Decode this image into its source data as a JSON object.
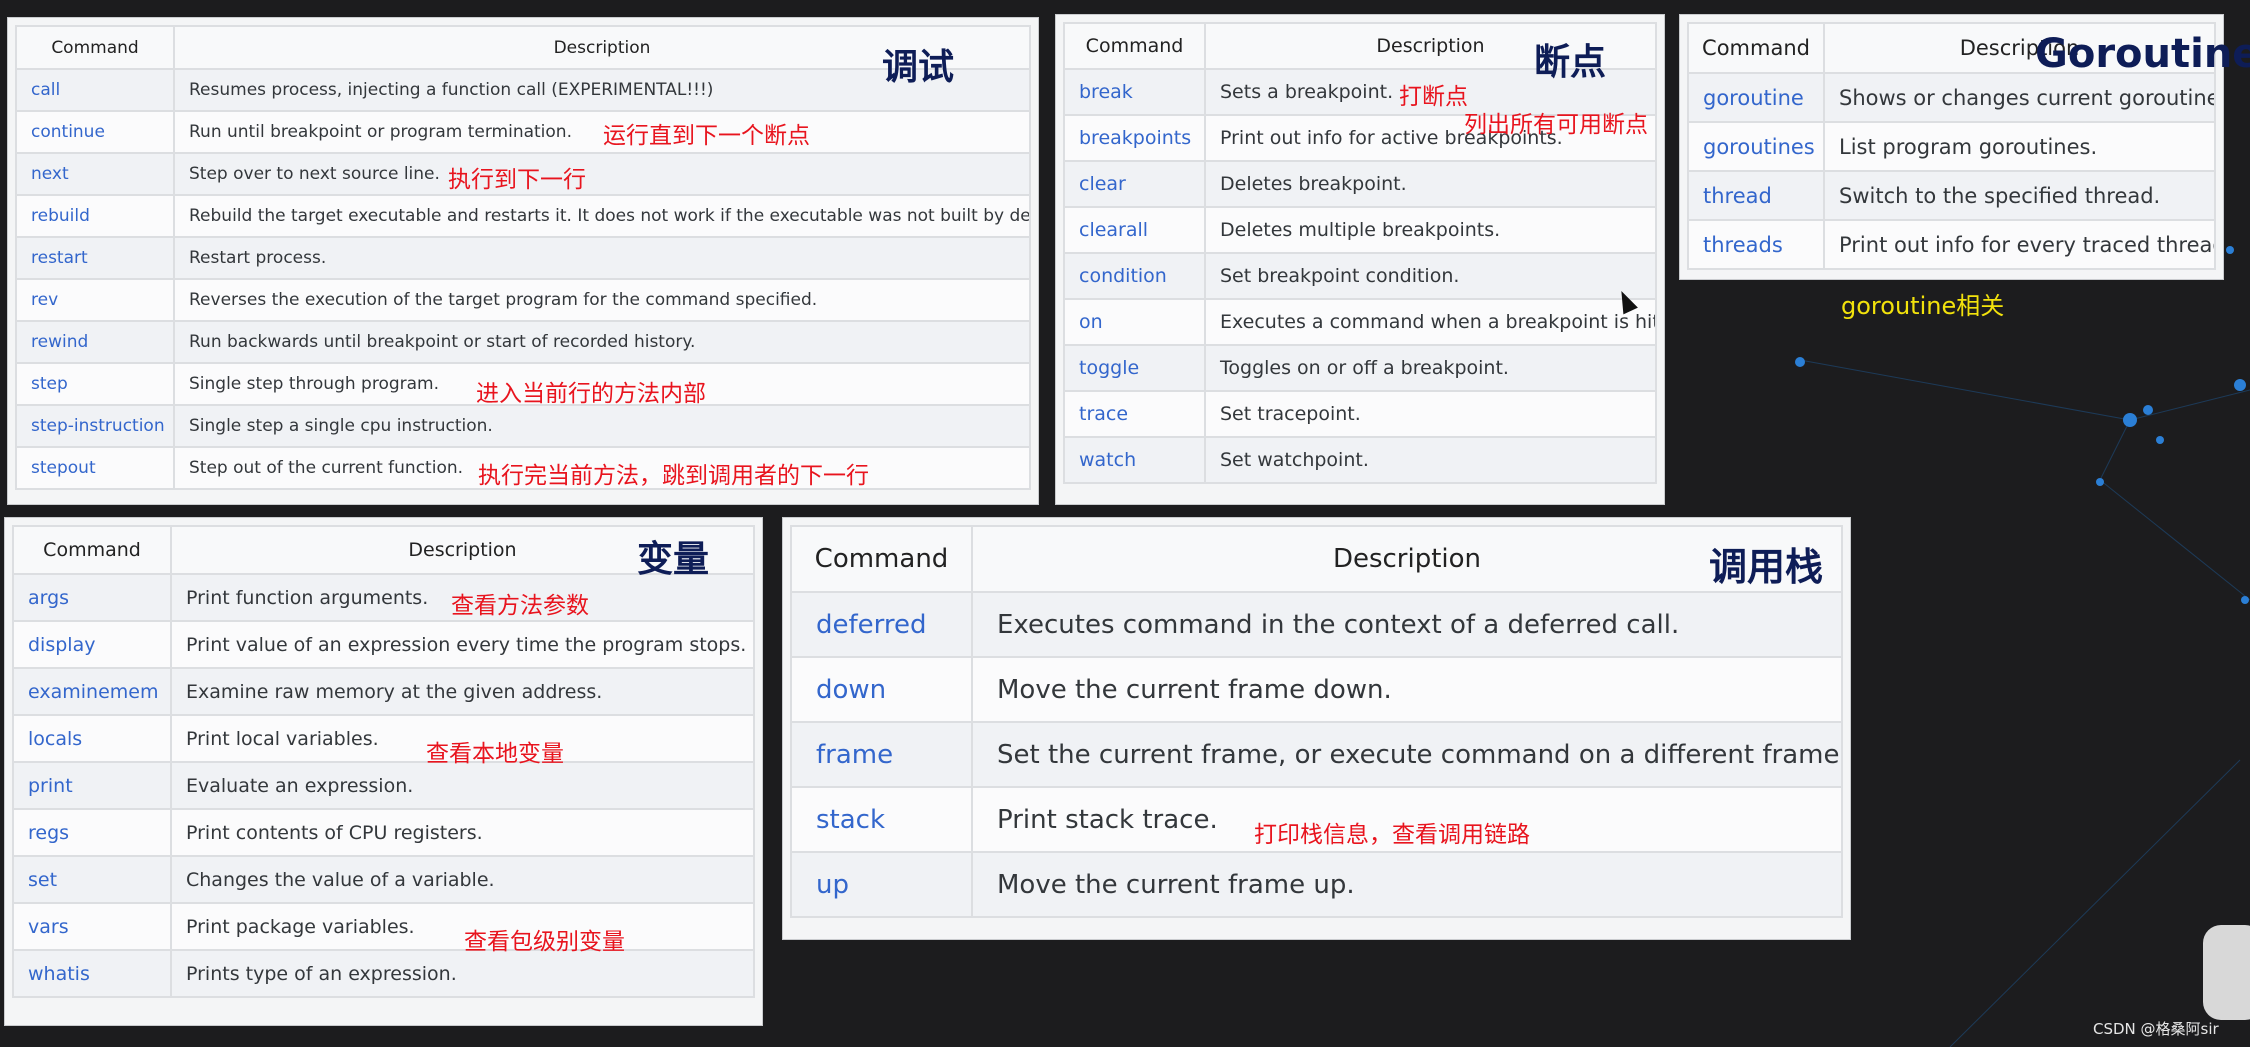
{
  "panels": [
    {
      "id": "p1",
      "title": "调试",
      "header": {
        "command": "Command",
        "description": "Description"
      },
      "rows": [
        {
          "command": "call",
          "description": "Resumes process, injecting a function call (EXPERIMENTAL!!!)"
        },
        {
          "command": "continue",
          "description": "Run until breakpoint or program termination."
        },
        {
          "command": "next",
          "description": "Step over to next source line."
        },
        {
          "command": "rebuild",
          "description": "Rebuild the target executable and restarts it. It does not work if the executable was not built by delve."
        },
        {
          "command": "restart",
          "description": "Restart process."
        },
        {
          "command": "rev",
          "description": "Reverses the execution of the target program for the command specified."
        },
        {
          "command": "rewind",
          "description": "Run backwards until breakpoint or start of recorded history."
        },
        {
          "command": "step",
          "description": "Single step through program."
        },
        {
          "command": "step-instruction",
          "description": "Single step a single cpu instruction."
        },
        {
          "command": "stepout",
          "description": "Step out of the current function."
        }
      ]
    },
    {
      "id": "p2",
      "title": "断点",
      "header": {
        "command": "Command",
        "description": "Description"
      },
      "rows": [
        {
          "command": "break",
          "description": "Sets a breakpoint."
        },
        {
          "command": "breakpoints",
          "description": "Print out info for active breakpoints."
        },
        {
          "command": "clear",
          "description": "Deletes breakpoint."
        },
        {
          "command": "clearall",
          "description": "Deletes multiple breakpoints."
        },
        {
          "command": "condition",
          "description": "Set breakpoint condition."
        },
        {
          "command": "on",
          "description": "Executes a command when a breakpoint is hit."
        },
        {
          "command": "toggle",
          "description": "Toggles on or off a breakpoint."
        },
        {
          "command": "trace",
          "description": "Set tracepoint."
        },
        {
          "command": "watch",
          "description": "Set watchpoint."
        }
      ]
    },
    {
      "id": "p3",
      "title": "Goroutine",
      "header": {
        "command": "Command",
        "description": "Description"
      },
      "rows": [
        {
          "command": "goroutine",
          "description": "Shows or changes current goroutine"
        },
        {
          "command": "goroutines",
          "description": "List program goroutines."
        },
        {
          "command": "thread",
          "description": "Switch to the specified thread."
        },
        {
          "command": "threads",
          "description": "Print out info for every traced thread."
        }
      ]
    },
    {
      "id": "p4",
      "title": "变量",
      "header": {
        "command": "Command",
        "description": "Description"
      },
      "rows": [
        {
          "command": "args",
          "description": "Print function arguments."
        },
        {
          "command": "display",
          "description": "Print value of an expression every time the program stops."
        },
        {
          "command": "examinemem",
          "description": "Examine raw memory at the given address."
        },
        {
          "command": "locals",
          "description": "Print local variables."
        },
        {
          "command": "print",
          "description": "Evaluate an expression."
        },
        {
          "command": "regs",
          "description": "Print contents of CPU registers."
        },
        {
          "command": "set",
          "description": "Changes the value of a variable."
        },
        {
          "command": "vars",
          "description": "Print package variables."
        },
        {
          "command": "whatis",
          "description": "Prints type of an expression."
        }
      ]
    },
    {
      "id": "p5",
      "title": "调用栈",
      "header": {
        "command": "Command",
        "description": "Description"
      },
      "rows": [
        {
          "command": "deferred",
          "description": "Executes command in the context of a deferred call."
        },
        {
          "command": "down",
          "description": "Move the current frame down."
        },
        {
          "command": "frame",
          "description": "Set the current frame, or execute command on a different frame."
        },
        {
          "command": "stack",
          "description": "Print stack trace."
        },
        {
          "command": "up",
          "description": "Move the current frame up."
        }
      ]
    }
  ],
  "annotations": {
    "continue": "运行直到下一个断点",
    "next": "执行到下一行",
    "step": "进入当前行的方法内部",
    "stepout": "执行完当前方法，跳到调用者的下一行",
    "break": "打断点",
    "breakpoints": "列出所有可用断点",
    "goroutine": "goroutine相关",
    "args": "查看方法参数",
    "locals": "查看本地变量",
    "vars": "查看包级别变量",
    "stack": "打印栈信息，查看调用链路"
  },
  "watermark": "CSDN @格桑阿sir",
  "colors": {
    "command_link": "#3366cc",
    "title": "#0e1d57",
    "annotation": "#e8141e",
    "annotation_yellow": "#f2e20c",
    "background": "#1c1c1e"
  }
}
